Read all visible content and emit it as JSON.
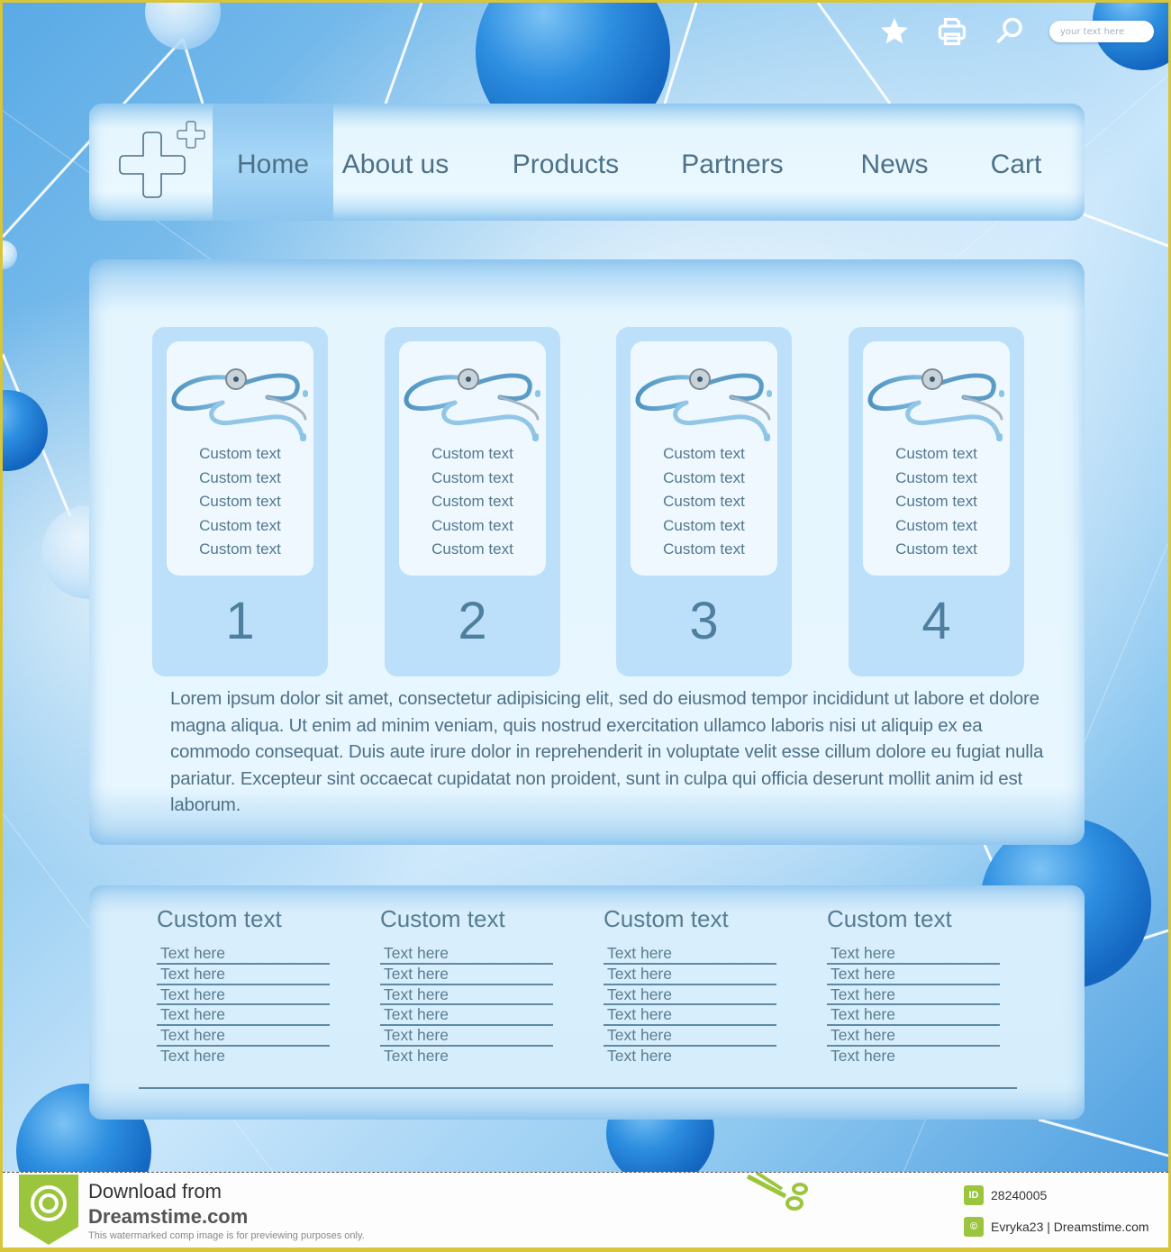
{
  "header": {
    "icons": [
      "star-icon",
      "printer-icon",
      "search-icon"
    ],
    "search_placeholder": "your text here"
  },
  "nav": {
    "logo": "medical-cross-logo",
    "items": [
      {
        "label": "Home",
        "active": true
      },
      {
        "label": "About us",
        "active": false
      },
      {
        "label": "Products",
        "active": false
      },
      {
        "label": "Partners",
        "active": false
      },
      {
        "label": "News",
        "active": false
      },
      {
        "label": "Cart",
        "active": false
      }
    ]
  },
  "cards": [
    {
      "number": "1",
      "image": "stethoscope",
      "lines": [
        "Custom text",
        "Custom text",
        "Custom text",
        "Custom text",
        "Custom text"
      ]
    },
    {
      "number": "2",
      "image": "stethoscope",
      "lines": [
        "Custom text",
        "Custom text",
        "Custom text",
        "Custom text",
        "Custom text"
      ]
    },
    {
      "number": "3",
      "image": "stethoscope",
      "lines": [
        "Custom text",
        "Custom text",
        "Custom text",
        "Custom text",
        "Custom text"
      ]
    },
    {
      "number": "4",
      "image": "stethoscope",
      "lines": [
        "Custom text",
        "Custom text",
        "Custom text",
        "Custom text",
        "Custom text"
      ]
    }
  ],
  "body_text": "Lorem ipsum dolor sit amet, consectetur adipisicing elit, sed do eiusmod tempor incididunt ut labore et dolore magna aliqua. Ut enim ad minim veniam, quis nostrud exercitation ullamco laboris nisi ut aliquip ex ea commodo consequat. Duis aute irure dolor in reprehenderit in voluptate velit esse cillum dolore eu fugiat nulla pariatur. Excepteur sint occaecat cupidatat non proident, sunt in culpa qui officia deserunt mollit anim id est laborum.",
  "footer": {
    "columns": [
      {
        "title": "Custom text",
        "links": [
          "Text here",
          "Text here",
          "Text here",
          "Text here",
          "Text here",
          "Text here"
        ]
      },
      {
        "title": "Custom text",
        "links": [
          "Text here",
          "Text here",
          "Text here",
          "Text here",
          "Text here",
          "Text here"
        ]
      },
      {
        "title": "Custom text",
        "links": [
          "Text here",
          "Text here",
          "Text here",
          "Text here",
          "Text here",
          "Text here"
        ]
      },
      {
        "title": "Custom text",
        "links": [
          "Text here",
          "Text here",
          "Text here",
          "Text here",
          "Text here",
          "Text here"
        ]
      }
    ]
  },
  "watermark": {
    "title": "Download from",
    "brand": "Dreamstime.com",
    "note": "This watermarked comp image is for previewing purposes only.",
    "id_label": "ID",
    "id_value": "28240005",
    "copyright_symbol": "©",
    "credit": "Evryka23 | Dreamstime.com"
  },
  "colors": {
    "text": "#4d7187",
    "accent": "#8cc5ef",
    "card": "#bde0fa",
    "watermark_green": "#9bc53d"
  }
}
